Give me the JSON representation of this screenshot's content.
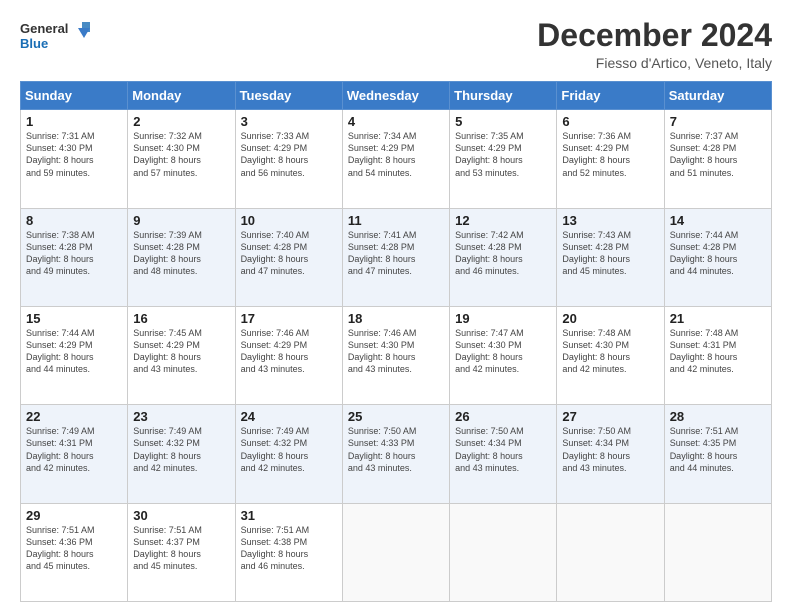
{
  "logo": {
    "line1": "General",
    "line2": "Blue"
  },
  "title": "December 2024",
  "subtitle": "Fiesso d'Artico, Veneto, Italy",
  "days_of_week": [
    "Sunday",
    "Monday",
    "Tuesday",
    "Wednesday",
    "Thursday",
    "Friday",
    "Saturday"
  ],
  "weeks": [
    [
      {
        "day": 1,
        "info": "Sunrise: 7:31 AM\nSunset: 4:30 PM\nDaylight: 8 hours\nand 59 minutes."
      },
      {
        "day": 2,
        "info": "Sunrise: 7:32 AM\nSunset: 4:30 PM\nDaylight: 8 hours\nand 57 minutes."
      },
      {
        "day": 3,
        "info": "Sunrise: 7:33 AM\nSunset: 4:29 PM\nDaylight: 8 hours\nand 56 minutes."
      },
      {
        "day": 4,
        "info": "Sunrise: 7:34 AM\nSunset: 4:29 PM\nDaylight: 8 hours\nand 54 minutes."
      },
      {
        "day": 5,
        "info": "Sunrise: 7:35 AM\nSunset: 4:29 PM\nDaylight: 8 hours\nand 53 minutes."
      },
      {
        "day": 6,
        "info": "Sunrise: 7:36 AM\nSunset: 4:29 PM\nDaylight: 8 hours\nand 52 minutes."
      },
      {
        "day": 7,
        "info": "Sunrise: 7:37 AM\nSunset: 4:28 PM\nDaylight: 8 hours\nand 51 minutes."
      }
    ],
    [
      {
        "day": 8,
        "info": "Sunrise: 7:38 AM\nSunset: 4:28 PM\nDaylight: 8 hours\nand 49 minutes."
      },
      {
        "day": 9,
        "info": "Sunrise: 7:39 AM\nSunset: 4:28 PM\nDaylight: 8 hours\nand 48 minutes."
      },
      {
        "day": 10,
        "info": "Sunrise: 7:40 AM\nSunset: 4:28 PM\nDaylight: 8 hours\nand 47 minutes."
      },
      {
        "day": 11,
        "info": "Sunrise: 7:41 AM\nSunset: 4:28 PM\nDaylight: 8 hours\nand 47 minutes."
      },
      {
        "day": 12,
        "info": "Sunrise: 7:42 AM\nSunset: 4:28 PM\nDaylight: 8 hours\nand 46 minutes."
      },
      {
        "day": 13,
        "info": "Sunrise: 7:43 AM\nSunset: 4:28 PM\nDaylight: 8 hours\nand 45 minutes."
      },
      {
        "day": 14,
        "info": "Sunrise: 7:44 AM\nSunset: 4:28 PM\nDaylight: 8 hours\nand 44 minutes."
      }
    ],
    [
      {
        "day": 15,
        "info": "Sunrise: 7:44 AM\nSunset: 4:29 PM\nDaylight: 8 hours\nand 44 minutes."
      },
      {
        "day": 16,
        "info": "Sunrise: 7:45 AM\nSunset: 4:29 PM\nDaylight: 8 hours\nand 43 minutes."
      },
      {
        "day": 17,
        "info": "Sunrise: 7:46 AM\nSunset: 4:29 PM\nDaylight: 8 hours\nand 43 minutes."
      },
      {
        "day": 18,
        "info": "Sunrise: 7:46 AM\nSunset: 4:30 PM\nDaylight: 8 hours\nand 43 minutes."
      },
      {
        "day": 19,
        "info": "Sunrise: 7:47 AM\nSunset: 4:30 PM\nDaylight: 8 hours\nand 42 minutes."
      },
      {
        "day": 20,
        "info": "Sunrise: 7:48 AM\nSunset: 4:30 PM\nDaylight: 8 hours\nand 42 minutes."
      },
      {
        "day": 21,
        "info": "Sunrise: 7:48 AM\nSunset: 4:31 PM\nDaylight: 8 hours\nand 42 minutes."
      }
    ],
    [
      {
        "day": 22,
        "info": "Sunrise: 7:49 AM\nSunset: 4:31 PM\nDaylight: 8 hours\nand 42 minutes."
      },
      {
        "day": 23,
        "info": "Sunrise: 7:49 AM\nSunset: 4:32 PM\nDaylight: 8 hours\nand 42 minutes."
      },
      {
        "day": 24,
        "info": "Sunrise: 7:49 AM\nSunset: 4:32 PM\nDaylight: 8 hours\nand 42 minutes."
      },
      {
        "day": 25,
        "info": "Sunrise: 7:50 AM\nSunset: 4:33 PM\nDaylight: 8 hours\nand 43 minutes."
      },
      {
        "day": 26,
        "info": "Sunrise: 7:50 AM\nSunset: 4:34 PM\nDaylight: 8 hours\nand 43 minutes."
      },
      {
        "day": 27,
        "info": "Sunrise: 7:50 AM\nSunset: 4:34 PM\nDaylight: 8 hours\nand 43 minutes."
      },
      {
        "day": 28,
        "info": "Sunrise: 7:51 AM\nSunset: 4:35 PM\nDaylight: 8 hours\nand 44 minutes."
      }
    ],
    [
      {
        "day": 29,
        "info": "Sunrise: 7:51 AM\nSunset: 4:36 PM\nDaylight: 8 hours\nand 45 minutes."
      },
      {
        "day": 30,
        "info": "Sunrise: 7:51 AM\nSunset: 4:37 PM\nDaylight: 8 hours\nand 45 minutes."
      },
      {
        "day": 31,
        "info": "Sunrise: 7:51 AM\nSunset: 4:38 PM\nDaylight: 8 hours\nand 46 minutes."
      },
      null,
      null,
      null,
      null
    ]
  ]
}
